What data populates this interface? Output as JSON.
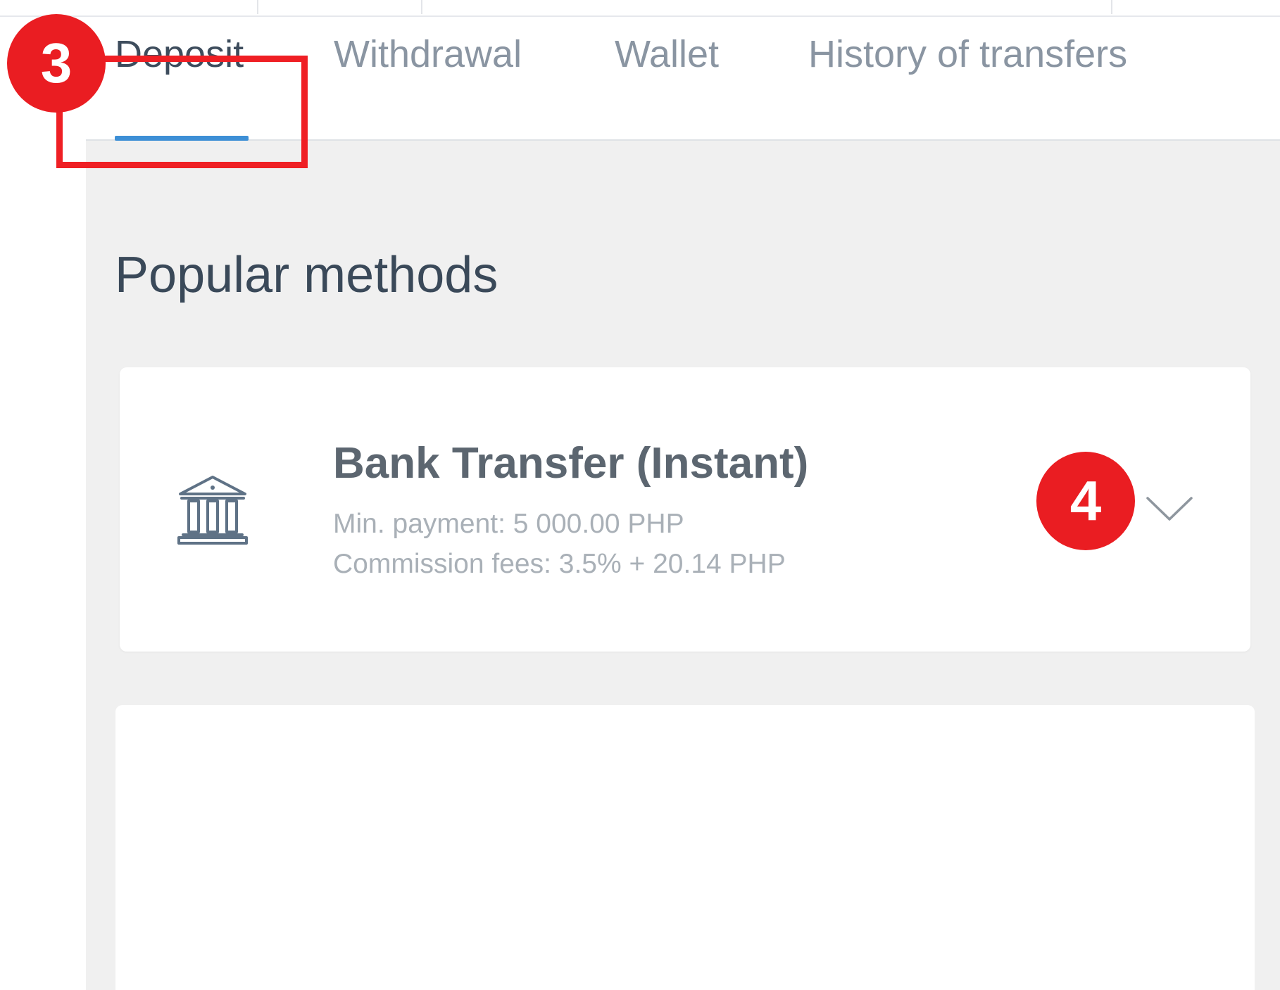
{
  "tabs": [
    {
      "label": "Deposit",
      "active": true
    },
    {
      "label": "Withdrawal",
      "active": false
    },
    {
      "label": "Wallet",
      "active": false
    },
    {
      "label": "History of transfers",
      "active": false
    }
  ],
  "section": {
    "title": "Popular methods"
  },
  "method": {
    "icon": "bank-icon",
    "name": "Bank Transfer (Instant)",
    "min_payment": "Min. payment: 5 000.00 PHP",
    "commission": "Commission fees: 3.5% + 20.14 PHP",
    "expand_icon": "chevron-down-icon"
  },
  "annotations": {
    "step3": "3",
    "step4": "4"
  },
  "colors": {
    "accent": "#3d8fd6",
    "annotation_red": "#ea1d22",
    "background_grey": "#f0f0f0"
  }
}
